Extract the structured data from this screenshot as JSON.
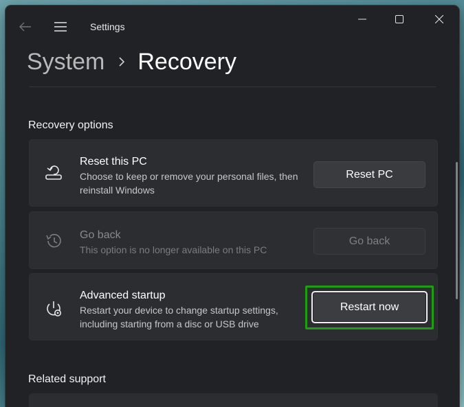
{
  "window": {
    "title": "Settings"
  },
  "breadcrumb": {
    "parent": "System",
    "current": "Recovery"
  },
  "sections": {
    "recovery_options": "Recovery options",
    "related_support": "Related support"
  },
  "cards": [
    {
      "icon": "reset-pc-icon",
      "title": "Reset this PC",
      "description": "Choose to keep or remove your personal files, then reinstall Windows",
      "button": "Reset PC",
      "enabled": true
    },
    {
      "icon": "history-icon",
      "title": "Go back",
      "description": "This option is no longer available on this PC",
      "button": "Go back",
      "enabled": false
    },
    {
      "icon": "advanced-startup-icon",
      "title": "Advanced startup",
      "description": "Restart your device to change startup settings, including starting from a disc or USB drive",
      "button": "Restart now",
      "enabled": true
    }
  ],
  "colors": {
    "window_bg": "#202225",
    "card_bg": "#2b2d30",
    "highlight": "#1f9e12"
  }
}
